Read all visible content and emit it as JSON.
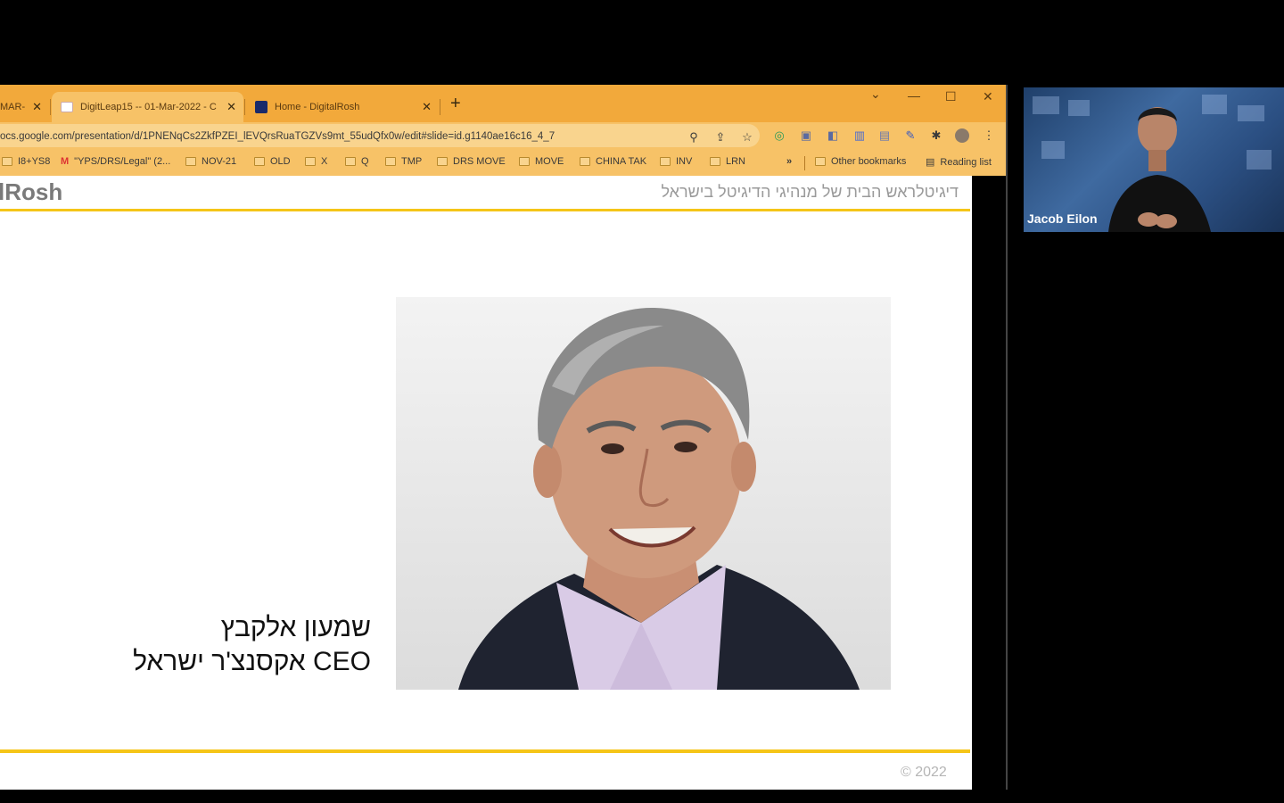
{
  "browser": {
    "tabs": [
      {
        "label": "MAR-",
        "active": false
      },
      {
        "label": "DigitLeap15 -- 01-Mar-2022 - C",
        "active": true
      },
      {
        "label": "Home - DigitalRosh",
        "active": false
      }
    ],
    "url": "ocs.google.com/presentation/d/1PNENqCs2ZkfPZEI_lEVQrsRuaTGZVs9mt_55udQfx0w/edit#slide=id.g1140ae16c16_4_7",
    "bookmarks": [
      "I8+YS8",
      "\"YPS/DRS/Legal\" (2...",
      "NOV-21",
      "OLD",
      "X",
      "Q",
      "TMP",
      "DRS MOVE",
      "MOVE",
      "CHINA TAK",
      "INV",
      "LRN"
    ],
    "other_bookmarks": "Other bookmarks",
    "reading_list": "Reading list",
    "colors": {
      "frame": "#f2a93b",
      "toolbar": "#f7c267"
    }
  },
  "slide": {
    "brand": "lRosh",
    "heading": "דיגיטלראש הבית של מנהיגי הדיגיטל בישראל",
    "name": "שמעון אלקבץ",
    "title": "CEO אקסנצ'ר ישראל",
    "copyright": "© 2022",
    "accent_color": "#f5c518"
  },
  "video": {
    "participant_name": "Jacob Eilon"
  }
}
